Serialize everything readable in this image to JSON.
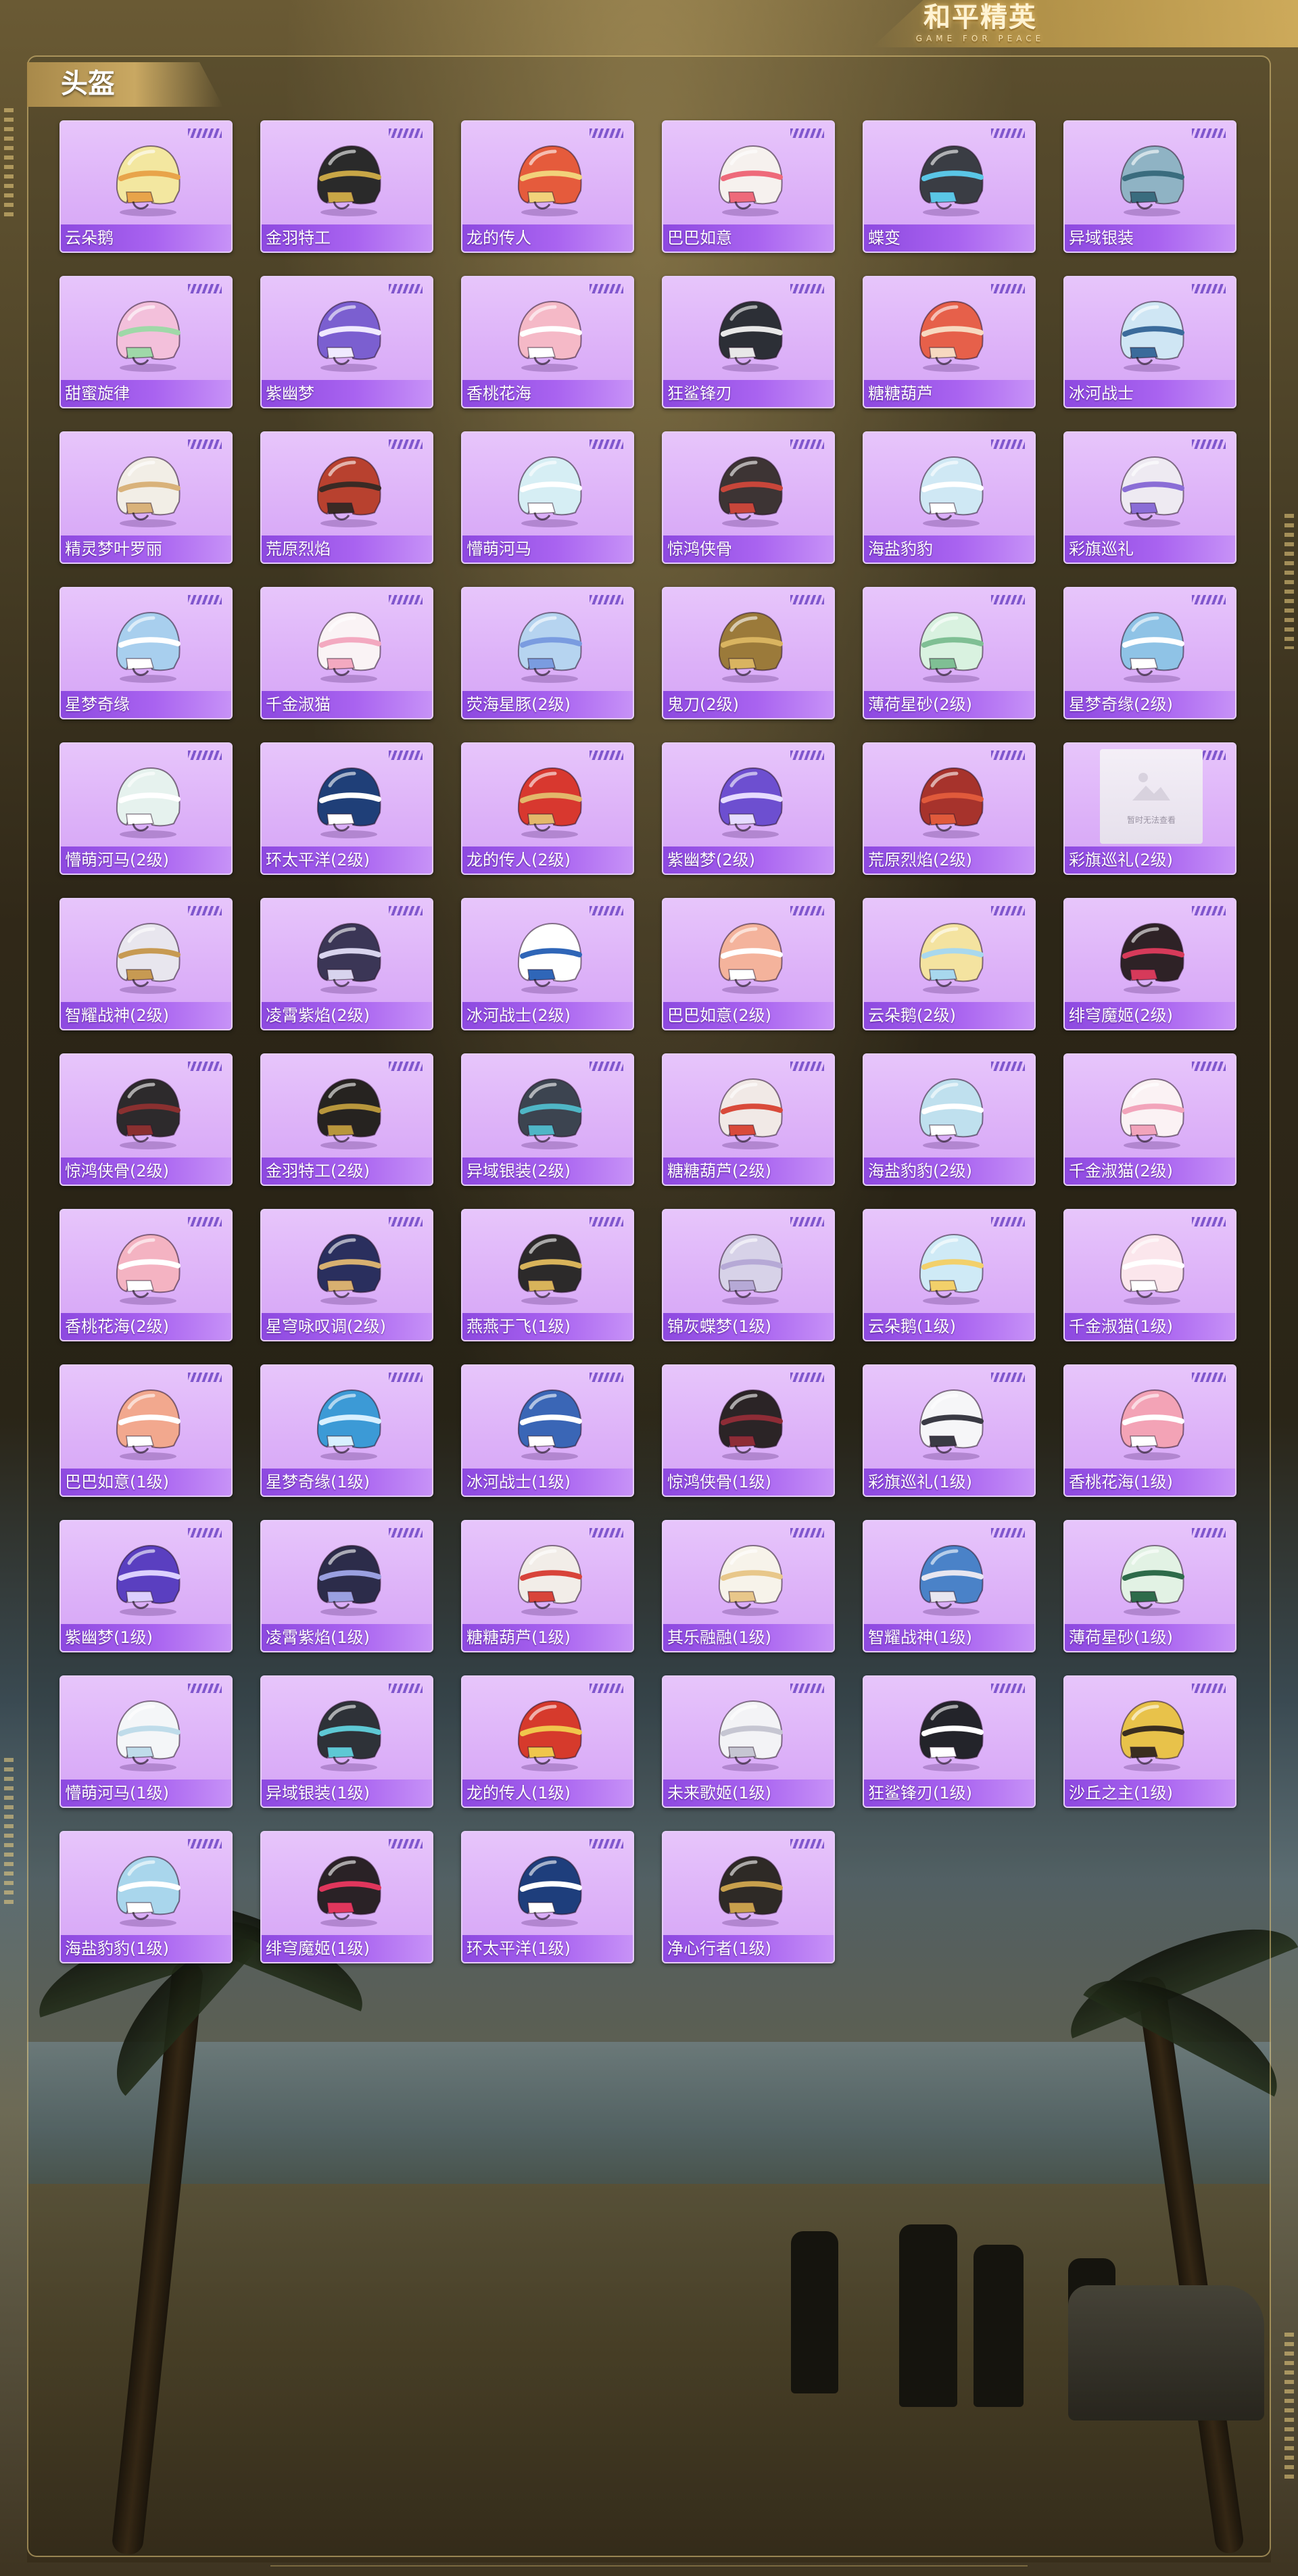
{
  "header": {
    "logo_title": "和平精英",
    "logo_subtitle": "GAME FOR PEACE"
  },
  "section": {
    "title": "头盔"
  },
  "colors": {
    "card_bg": "#dcb0f8",
    "card_label_bg": "#a963f0",
    "accent_gold": "#c9a862"
  },
  "placeholder_text": "暂时无法查看",
  "items": [
    {
      "name": "云朵鹅",
      "icon": "cloud-goose-helmet-icon",
      "color": "#f3e7a0",
      "accent": "#e8a44a"
    },
    {
      "name": "金羽特工",
      "icon": "gold-feather-agent-helmet-icon",
      "color": "#2a2a2a",
      "accent": "#c8a646"
    },
    {
      "name": "龙的传人",
      "icon": "dragon-heir-helmet-icon",
      "color": "#e55b3c",
      "accent": "#f2d27a"
    },
    {
      "name": "巴巴如意",
      "icon": "baba-ruyi-helmet-icon",
      "color": "#f6f1ee",
      "accent": "#ee6a7a"
    },
    {
      "name": "蝶变",
      "icon": "butterfly-helmet-icon",
      "color": "#3a3d44",
      "accent": "#5ac6e6"
    },
    {
      "name": "异域银装",
      "icon": "exotic-silver-helmet-icon",
      "color": "#8fb3c4",
      "accent": "#3a6c7e"
    },
    {
      "name": "甜蜜旋律",
      "icon": "sweet-melody-helmet-icon",
      "color": "#f3c0db",
      "accent": "#9fd8a8"
    },
    {
      "name": "紫幽梦",
      "icon": "purple-dream-helmet-icon",
      "color": "#7b5fd0",
      "accent": "#f0eaff"
    },
    {
      "name": "香桃花海",
      "icon": "peach-blossom-helmet-icon",
      "color": "#f5b9c7",
      "accent": "#ffffff"
    },
    {
      "name": "狂鲨锋刃",
      "icon": "mad-shark-helmet-icon",
      "color": "#2c2f36",
      "accent": "#e8e8e8"
    },
    {
      "name": "糖糖葫芦",
      "icon": "candied-haws-helmet-icon",
      "color": "#e6604a",
      "accent": "#f7d9c0"
    },
    {
      "name": "冰河战士",
      "icon": "glacier-warrior-helmet-icon",
      "color": "#cfe6f4",
      "accent": "#3b6b9b"
    },
    {
      "name": "精灵梦叶罗丽",
      "icon": "elf-dream-helmet-icon",
      "color": "#f2eee6",
      "accent": "#d9b27a"
    },
    {
      "name": "荒原烈焰",
      "icon": "wasteland-flame-helmet-icon",
      "color": "#b8412f",
      "accent": "#3a2a24"
    },
    {
      "name": "懵萌河马",
      "icon": "cute-hippo-helmet-icon",
      "color": "#d6eef4",
      "accent": "#ffffff"
    },
    {
      "name": "惊鸿侠骨",
      "icon": "swan-hero-helmet-icon",
      "color": "#3d3434",
      "accent": "#c8463a"
    },
    {
      "name": "海盐豹豹",
      "icon": "sea-salt-leopard-helmet-icon",
      "color": "#cfe8f4",
      "accent": "#ffffff"
    },
    {
      "name": "彩旗巡礼",
      "icon": "flag-parade-helmet-icon",
      "color": "#eeeaf2",
      "accent": "#8a6dd6"
    },
    {
      "name": "星梦奇缘",
      "icon": "star-dream-helmet-icon",
      "color": "#a8cfee",
      "accent": "#ffffff"
    },
    {
      "name": "千金淑猫",
      "icon": "lady-cat-helmet-icon",
      "color": "#faf3f5",
      "accent": "#f3a9c0"
    },
    {
      "name": "荧海星豚(2级)",
      "icon": "glow-sea-dolphin-helmet-icon",
      "color": "#b6d4f0",
      "accent": "#7a9ce0"
    },
    {
      "name": "鬼刀(2级)",
      "icon": "ghost-blade-helmet-icon",
      "color": "#9b7a3a",
      "accent": "#d9b460"
    },
    {
      "name": "薄荷星砂(2级)",
      "icon": "mint-star-sand-helmet-icon",
      "color": "#d9f2e0",
      "accent": "#7fbf94"
    },
    {
      "name": "星梦奇缘(2级)",
      "icon": "star-dream-helmet-icon",
      "color": "#8fc3e6",
      "accent": "#ffffff"
    },
    {
      "name": "懵萌河马(2级)",
      "icon": "cute-hippo-helmet-icon",
      "color": "#e6f2ee",
      "accent": "#ffffff"
    },
    {
      "name": "环太平洋(2级)",
      "icon": "pacific-rim-helmet-icon",
      "color": "#1f3f78",
      "accent": "#ffffff"
    },
    {
      "name": "龙的传人(2级)",
      "icon": "dragon-heir-helmet-icon",
      "color": "#d8382f",
      "accent": "#e3b86a"
    },
    {
      "name": "紫幽梦(2级)",
      "icon": "purple-dream-helmet-icon",
      "color": "#6d4fd0",
      "accent": "#e6dcff"
    },
    {
      "name": "荒原烈焰(2级)",
      "icon": "wasteland-flame-helmet-icon",
      "color": "#a7332c",
      "accent": "#e05a3b"
    },
    {
      "name": "彩旗巡礼(2级)",
      "icon": "image-placeholder-icon",
      "color": "#f0edf2",
      "accent": "#c8c8d0",
      "placeholder": true
    },
    {
      "name": "智耀战神(2级)",
      "icon": "wisdom-war-god-helmet-icon",
      "color": "#e8e6ee",
      "accent": "#c79a52"
    },
    {
      "name": "凌霄紫焰(2级)",
      "icon": "sky-purple-flame-helmet-icon",
      "color": "#3b3656",
      "accent": "#d8d4ee"
    },
    {
      "name": "冰河战士(2级)",
      "icon": "glacier-warrior-helmet-icon",
      "color": "#ffffff",
      "accent": "#2f66b8"
    },
    {
      "name": "巴巴如意(2级)",
      "icon": "baba-ruyi-helmet-icon",
      "color": "#f4b39c",
      "accent": "#ffffff"
    },
    {
      "name": "云朵鹅(2级)",
      "icon": "cloud-goose-helmet-icon",
      "color": "#f4e3a0",
      "accent": "#a8d8ee"
    },
    {
      "name": "绯穹魔姬(2级)",
      "icon": "crimson-sky-witch-helmet-icon",
      "color": "#2e2226",
      "accent": "#d63a5a"
    },
    {
      "name": "惊鸿侠骨(2级)",
      "icon": "swan-hero-helmet-icon",
      "color": "#2d2a2c",
      "accent": "#8a3030"
    },
    {
      "name": "金羽特工(2级)",
      "icon": "gold-feather-agent-helmet-icon",
      "color": "#262320",
      "accent": "#b8963c"
    },
    {
      "name": "异域银装(2级)",
      "icon": "exotic-silver-helmet-icon",
      "color": "#3c4450",
      "accent": "#4fb6c6"
    },
    {
      "name": "糖糖葫芦(2级)",
      "icon": "candied-haws-helmet-icon",
      "color": "#f1e9e6",
      "accent": "#d94a3a"
    },
    {
      "name": "海盐豹豹(2级)",
      "icon": "sea-salt-leopard-helmet-icon",
      "color": "#bfe0ee",
      "accent": "#ffffff"
    },
    {
      "name": "千金淑猫(2级)",
      "icon": "lady-cat-helmet-icon",
      "color": "#fbf2f4",
      "accent": "#f2a4bb"
    },
    {
      "name": "香桃花海(2级)",
      "icon": "peach-blossom-helmet-icon",
      "color": "#f4b3c2",
      "accent": "#ffffff"
    },
    {
      "name": "星穹咏叹调(2级)",
      "icon": "star-dome-aria-helmet-icon",
      "color": "#2a2f5e",
      "accent": "#d8b070"
    },
    {
      "name": "燕燕于飞(1级)",
      "icon": "swallow-flight-helmet-icon",
      "color": "#2c2a2a",
      "accent": "#d8b35a"
    },
    {
      "name": "锦灰蝶梦(1级)",
      "icon": "brocade-butterfly-helmet-icon",
      "color": "#d7d2e8",
      "accent": "#b6a9d6"
    },
    {
      "name": "云朵鹅(1级)",
      "icon": "cloud-goose-helmet-icon",
      "color": "#cfeaf6",
      "accent": "#f2d06a"
    },
    {
      "name": "千金淑猫(1级)",
      "icon": "lady-cat-helmet-icon",
      "color": "#fbe6ec",
      "accent": "#ffffff"
    },
    {
      "name": "巴巴如意(1级)",
      "icon": "baba-ruyi-helmet-icon",
      "color": "#f2a88e",
      "accent": "#ffffff"
    },
    {
      "name": "星梦奇缘(1级)",
      "icon": "star-dream-helmet-icon",
      "color": "#3c9ad6",
      "accent": "#d8f0ff"
    },
    {
      "name": "冰河战士(1级)",
      "icon": "glacier-warrior-helmet-icon",
      "color": "#3a66b6",
      "accent": "#ffffff"
    },
    {
      "name": "惊鸿侠骨(1级)",
      "icon": "swan-hero-helmet-icon",
      "color": "#2b2426",
      "accent": "#8e2c36"
    },
    {
      "name": "彩旗巡礼(1级)",
      "icon": "flag-parade-helmet-icon",
      "color": "#f6f6f8",
      "accent": "#3a3a44"
    },
    {
      "name": "香桃花海(1级)",
      "icon": "peach-blossom-helmet-icon",
      "color": "#f3a3b6",
      "accent": "#ffffff"
    },
    {
      "name": "紫幽梦(1级)",
      "icon": "purple-dream-helmet-icon",
      "color": "#5a3fc0",
      "accent": "#dcd0ff"
    },
    {
      "name": "凌霄紫焰(1级)",
      "icon": "sky-purple-flame-helmet-icon",
      "color": "#2c2c4a",
      "accent": "#9aa0e0"
    },
    {
      "name": "糖糖葫芦(1级)",
      "icon": "candied-haws-helmet-icon",
      "color": "#f2ede8",
      "accent": "#d8443a"
    },
    {
      "name": "其乐融融(1级)",
      "icon": "happy-together-helmet-icon",
      "color": "#f7f3ea",
      "accent": "#e8c78a"
    },
    {
      "name": "智耀战神(1级)",
      "icon": "wisdom-war-god-helmet-icon",
      "color": "#4a82c8",
      "accent": "#e8e6f0"
    },
    {
      "name": "薄荷星砂(1级)",
      "icon": "mint-star-sand-helmet-icon",
      "color": "#e2f2e4",
      "accent": "#2e6b4a"
    },
    {
      "name": "懵萌河马(1级)",
      "icon": "cute-hippo-helmet-icon",
      "color": "#f4f6f8",
      "accent": "#bfdcea"
    },
    {
      "name": "异域银装(1级)",
      "icon": "exotic-silver-helmet-icon",
      "color": "#2e3238",
      "accent": "#5ec8d4"
    },
    {
      "name": "龙的传人(1级)",
      "icon": "dragon-heir-helmet-icon",
      "color": "#d63a2c",
      "accent": "#f0c64c"
    },
    {
      "name": "未来歌姬(1级)",
      "icon": "future-diva-helmet-icon",
      "color": "#f3f3f6",
      "accent": "#c6c6d2"
    },
    {
      "name": "狂鲨锋刃(1级)",
      "icon": "mad-shark-helmet-icon",
      "color": "#23242a",
      "accent": "#ffffff"
    },
    {
      "name": "沙丘之主(1级)",
      "icon": "dune-lord-helmet-icon",
      "color": "#e8c24a",
      "accent": "#3a2e20"
    },
    {
      "name": "海盐豹豹(1级)",
      "icon": "sea-salt-leopard-helmet-icon",
      "color": "#a9d6ec",
      "accent": "#ffffff"
    },
    {
      "name": "绯穹魔姬(1级)",
      "icon": "crimson-sky-witch-helmet-icon",
      "color": "#2a2226",
      "accent": "#e0365c"
    },
    {
      "name": "环太平洋(1级)",
      "icon": "pacific-rim-helmet-icon",
      "color": "#1e3e7c",
      "accent": "#ffffff"
    },
    {
      "name": "净心行者(1级)",
      "icon": "pure-heart-walker-helmet-icon",
      "color": "#2e2a26",
      "accent": "#c8a04c"
    }
  ]
}
